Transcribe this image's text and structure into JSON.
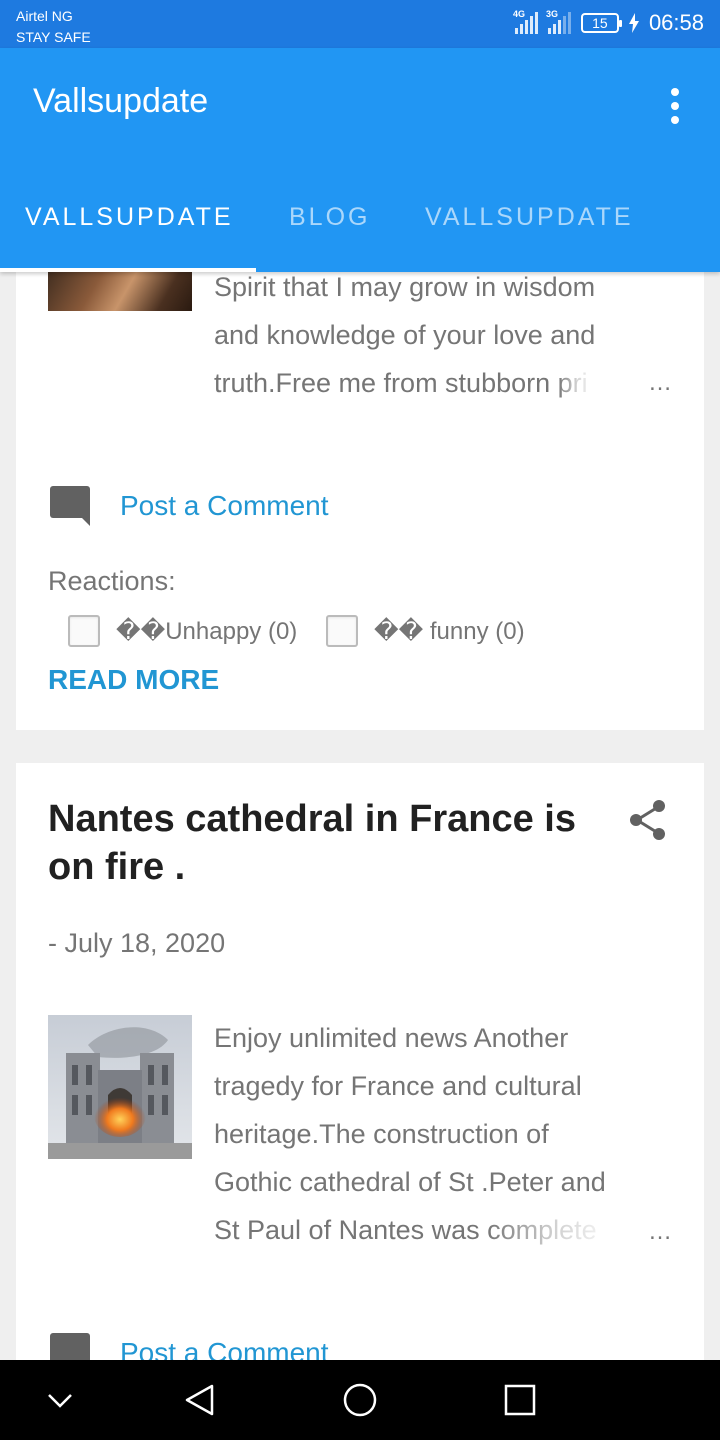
{
  "status_bar": {
    "carrier": "Airtel NG",
    "notice": "STAY SAFE",
    "sig1_label": "4G",
    "sig2_label": "3G",
    "battery": "15",
    "time": "06:58"
  },
  "app_bar": {
    "title": "Vallsupdate",
    "menu_icon": "more-vert-icon"
  },
  "tabs": [
    {
      "label": "VALLSUPDATE",
      "selected": true
    },
    {
      "label": "BLOG",
      "selected": false
    },
    {
      "label": "VALLSUPDATE",
      "selected": false
    }
  ],
  "post1": {
    "snippet_lines": [
      "Spirit that I may grow in wisdom",
      "and knowledge of your love and",
      "truth.Free me from stubborn "
    ],
    "snippet_fade": "pri",
    "ellipsis": "…",
    "comment_label": "Post a Comment",
    "reactions_label": "Reactions:",
    "reactions": [
      {
        "label": "��Unhappy (0)"
      },
      {
        "label": "�� funny (0)"
      }
    ],
    "read_more": "READ MORE"
  },
  "post2": {
    "title": "Nantes cathedral in France is on fire .",
    "date": "- July 18, 2020",
    "snippet_lines": [
      "Enjoy unlimited news Another",
      "tragedy for France and  cultural",
      "heritage.The construction of",
      "Gothic cathedral of St .Peter and",
      "St Paul of Nantes was "
    ],
    "snippet_fade": "complete",
    "ellipsis": "…",
    "comment_label": "Post a Comment"
  },
  "nav_bar": {
    "icons": [
      "chevron-down-icon",
      "back-icon",
      "home-icon",
      "recents-icon"
    ]
  },
  "colors": {
    "status_bar": "#1e7ae0",
    "app_bar": "#2196f3",
    "link": "#2196d3"
  }
}
